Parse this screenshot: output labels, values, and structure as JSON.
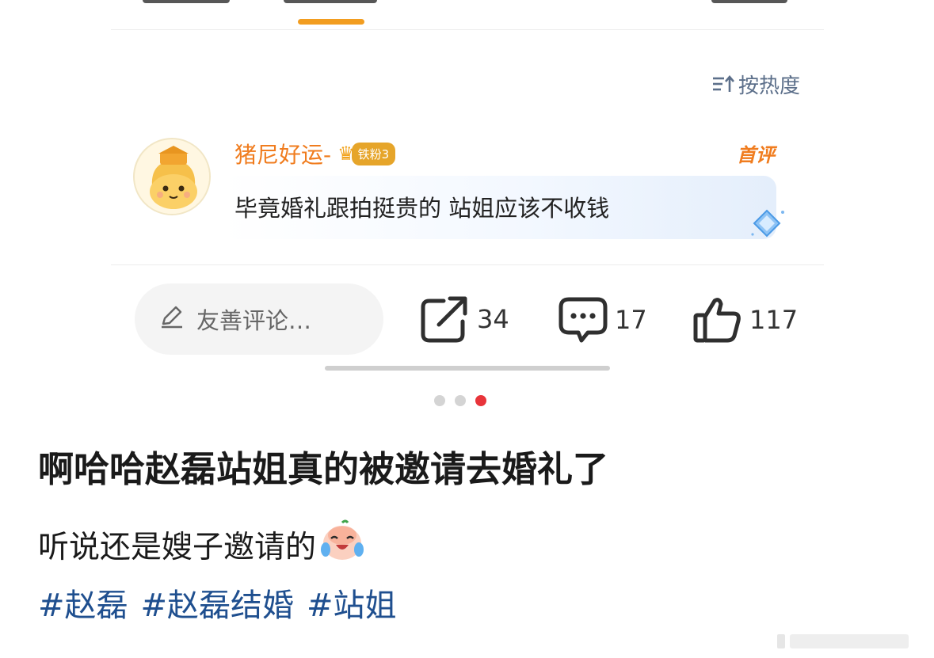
{
  "comment_card": {
    "sort_label": "按热度",
    "sort_icon": "sort-icon",
    "comment": {
      "username": "猪尼好运-",
      "fan_badge": "铁粉3",
      "first_tag": "首评",
      "text": "毕竟婚礼跟拍挺贵的 站姐应该不收钱"
    },
    "actions": {
      "input_placeholder": "友善评论…",
      "share_count": "34",
      "comment_count": "17",
      "like_count": "117"
    },
    "colors": {
      "accent": "#f29d20",
      "username": "#f07c1e",
      "sort": "#5c6f8a"
    }
  },
  "pager": {
    "total": 3,
    "active": 3
  },
  "post": {
    "title": "啊哈哈赵磊站姐真的被邀请去婚礼了",
    "text": "听说还是嫂子邀请的",
    "emoji": "laughing-crying-emoji",
    "hashtags": [
      "#赵磊",
      "#赵磊结婚",
      "#站姐"
    ],
    "hashtag_color": "#1f4f8f"
  }
}
